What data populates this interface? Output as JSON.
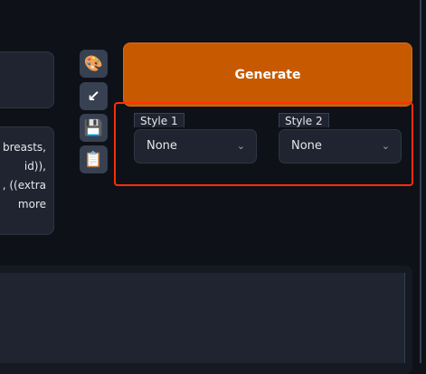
{
  "prompt": {
    "lines": [
      "breasts,",
      "id)),",
      ", ((extra",
      "more"
    ]
  },
  "tools": [
    {
      "name": "palette-icon",
      "glyph": "🎨"
    },
    {
      "name": "arrow-down-left-icon",
      "glyph": "↙"
    },
    {
      "name": "save-icon",
      "glyph": "💾"
    },
    {
      "name": "clipboard-icon",
      "glyph": "📋"
    }
  ],
  "generate": {
    "label": "Generate"
  },
  "styles": [
    {
      "label": "Style 1",
      "value": "None"
    },
    {
      "label": "Style 2",
      "value": "None"
    }
  ],
  "colors": {
    "accent": "#c75a00",
    "highlight": "#ff2d0a"
  }
}
